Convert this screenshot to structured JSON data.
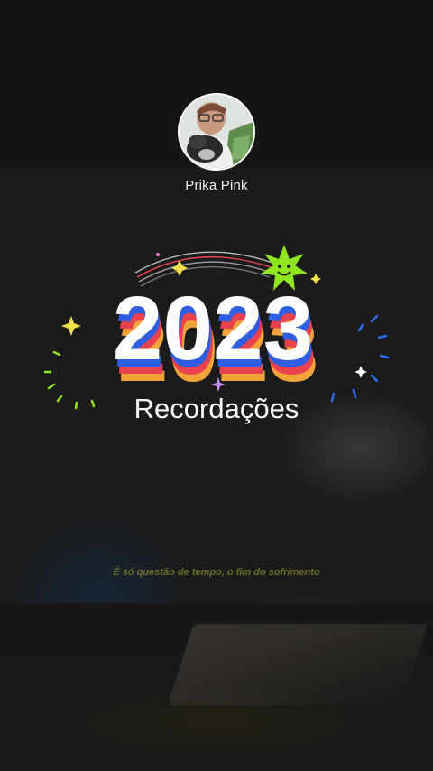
{
  "profile": {
    "user_name": "Prika Pink",
    "avatar_icon": "profile-photo"
  },
  "recap": {
    "year": "2023",
    "label": "Recordações"
  },
  "video": {
    "caption": "É só questão de tempo, o fim do sofrimento"
  },
  "colors": {
    "background": "#141414",
    "year_fill": "#ffffff",
    "stripe_red": "#e8424f",
    "stripe_blue": "#2f5fe0",
    "stripe_orange": "#f2a33a",
    "sparkle_green": "#8fe51e",
    "sparkle_yellow": "#f4e04a",
    "sparkle_blue": "#2f6cf0",
    "caption": "#8a8a30"
  }
}
